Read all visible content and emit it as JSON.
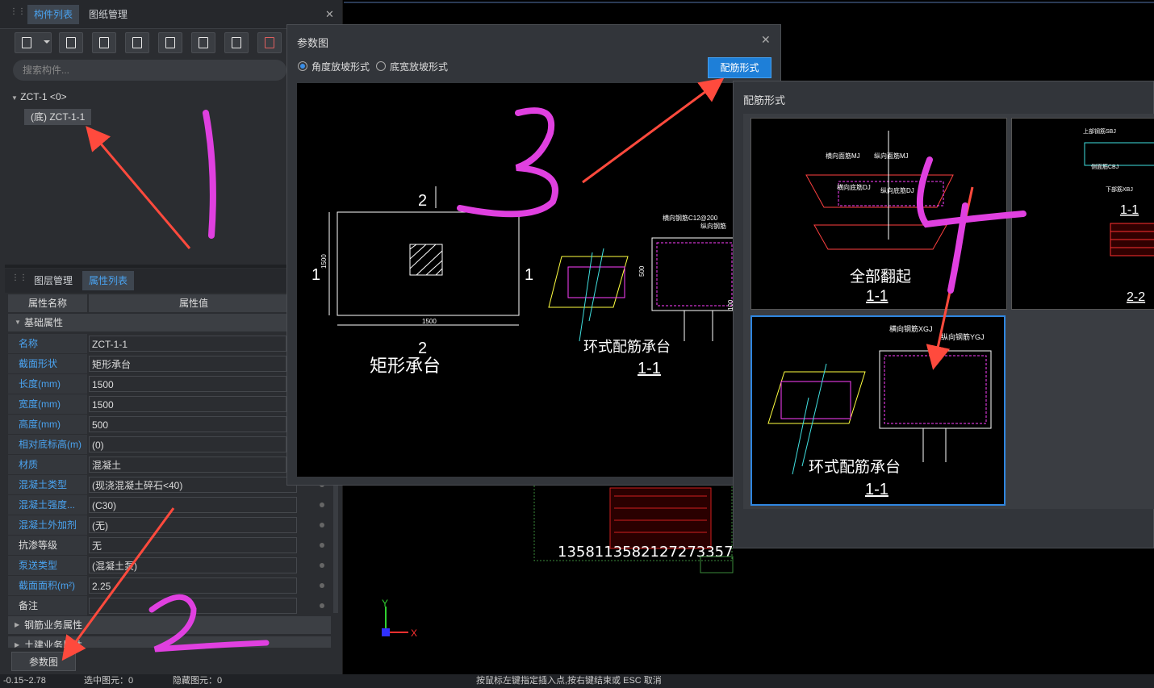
{
  "left_panel": {
    "tabs": [
      "构件列表",
      "图纸管理"
    ],
    "search_placeholder": "搜索构件...",
    "tree_root": "ZCT-1 <0>",
    "tree_child": "(底) ZCT-1-1",
    "tabs2": [
      "图层管理",
      "属性列表"
    ],
    "col_name": "属性名称",
    "col_value": "属性值",
    "group_basic": "基础属性",
    "props": [
      {
        "name": "名称",
        "value": "ZCT-1-1"
      },
      {
        "name": "截面形状",
        "value": "矩形承台"
      },
      {
        "name": "长度(mm)",
        "value": "1500"
      },
      {
        "name": "宽度(mm)",
        "value": "1500"
      },
      {
        "name": "高度(mm)",
        "value": "500"
      },
      {
        "name": "相对底标高(m)",
        "value": "(0)"
      },
      {
        "name": "材质",
        "value": "混凝土"
      },
      {
        "name": "混凝土类型",
        "value": "(现浇混凝土碎石<40)"
      },
      {
        "name": "混凝土强度...",
        "value": "(C30)"
      },
      {
        "name": "混凝土外加剂",
        "value": "(无)"
      },
      {
        "name": "抗渗等级",
        "value": "无"
      },
      {
        "name": "泵送类型",
        "value": "(混凝土泵)"
      },
      {
        "name": "截面面积(m²)",
        "value": "2.25"
      },
      {
        "name": "备注",
        "value": ""
      }
    ],
    "group_rebar": "钢筋业务属性",
    "group_civil": "土建业务属性",
    "param_button": "参数图"
  },
  "status": {
    "coord": "-0.15~2.78",
    "selected": "选中图元：0",
    "hidden": "隐藏图元：0",
    "hint": "按鼠标左键指定插入点,按右键结束或 ESC 取消"
  },
  "dialog": {
    "title": "参数图",
    "radio1": "角度放坡形式",
    "radio2": "底宽放坡形式",
    "button": "配筋形式",
    "drawing": {
      "label_top": "2",
      "label_bottom": "2",
      "label_left": "1",
      "label_right": "1",
      "dim_w": "1500",
      "dim_h": "1500",
      "caption": "矩形承台",
      "ring_caption": "环式配筋承台",
      "ring_section": "1-1",
      "ring_horiz": "横向钢筋C12@200",
      "ring_vert": "纵向钢筋",
      "dim_500": "500",
      "dim_100": "100"
    }
  },
  "popup": {
    "title": "配筋形式",
    "opt1_caption": "全部翻起",
    "opt1_section": "1-1",
    "opt2_sections": [
      "1-1",
      "2-2"
    ],
    "opt3_caption": "环式配筋承台",
    "opt3_section": "1-1",
    "opt3_horiz": "横向钢筋XGJ",
    "opt3_vert": "纵向钢筋YGJ",
    "opt1_labels": [
      "横向面筋MJ",
      "纵向面筋MJ",
      "横向底筋DJ",
      "纵向底筋DJ"
    ],
    "opt2_labels": [
      "上部钢筋SBJ",
      "侧面筋CBJ",
      "下部筋XBJ"
    ]
  },
  "bg": {
    "numbers": "1358113582127273357",
    "axis_y": "Y",
    "axis_x": "X"
  },
  "annotations": [
    "1",
    "2",
    "3",
    "4"
  ],
  "colors": {
    "accent": "#1e7fd8",
    "annotation": "#e040e0",
    "arrow": "#ff4a3d"
  }
}
